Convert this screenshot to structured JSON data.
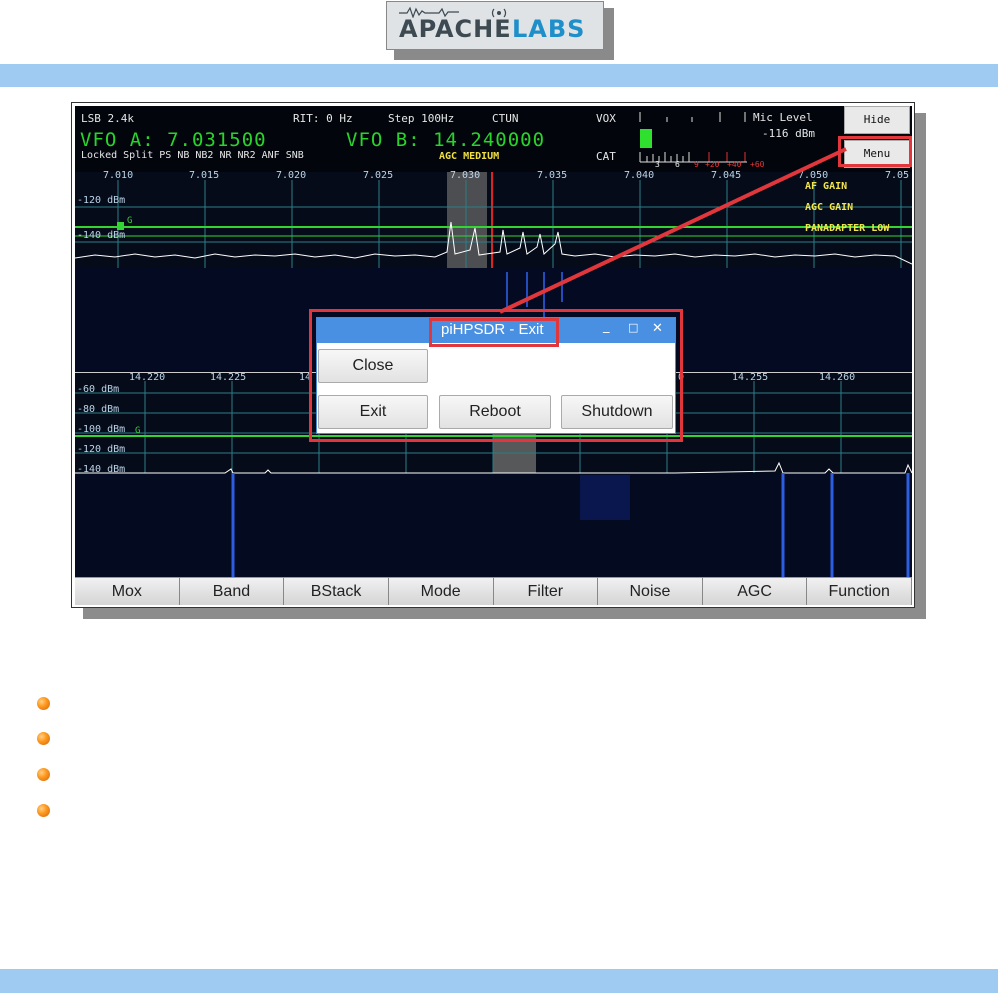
{
  "logo": {
    "word1": "APACHE",
    "word2": "LABS"
  },
  "radio": {
    "header": {
      "mode": "LSB 2.4k",
      "rit": "RIT: 0 Hz",
      "step": "Step 100Hz",
      "ctun": "CTUN",
      "vox": "VOX",
      "mic_level": "Mic Level",
      "mic_dbm": "-116 dBm",
      "cat": "CAT",
      "meter_ticks": [
        "3",
        "6",
        "9",
        "+20",
        "+40",
        "+60"
      ]
    },
    "vfo_a": "VFO A: 7.031500",
    "vfo_b": "VFO B: 14.240000",
    "status_line": "Locked Split  PS    NB  NB2 NR  NR2 ANF SNB",
    "agc_label": "AGC MEDIUM",
    "hide_label": "Hide",
    "menu_label": "Menu",
    "panadapter_a": {
      "freq_ticks": [
        "7.010",
        "7.015",
        "7.020",
        "7.025",
        "7.030",
        "7.035",
        "7.040",
        "7.045",
        "7.050",
        "7.05"
      ],
      "dbm_ticks": [
        "-120 dBm",
        "-140 dBm"
      ],
      "g_marker": "G",
      "slider_labels": [
        "AF GAIN",
        "AGC GAIN",
        "PANADAPTER LOW"
      ]
    },
    "panadapter_b": {
      "freq_ticks": [
        "14.220",
        "14.225",
        "14",
        "0",
        "14.255",
        "14.260"
      ],
      "dbm_ticks": [
        "-60 dBm",
        "-80 dBm",
        "-100 dBm",
        "-120 dBm",
        "-140 dBm"
      ],
      "g_marker": "G"
    },
    "toolbar": [
      "Mox",
      "Band",
      "BStack",
      "Mode",
      "Filter",
      "Noise",
      "AGC",
      "Function"
    ],
    "dialog": {
      "title": "piHPSDR - Exit",
      "minimize": "_",
      "maximize": "□",
      "close_icon": "✕",
      "close_btn": "Close",
      "exit_btn": "Exit",
      "reboot_btn": "Reboot",
      "shutdown_btn": "Shutdown"
    }
  },
  "colors": {
    "bluebar": "#9fcbf3",
    "vfo_green": "#29d42a",
    "annotation_red": "#e0363c",
    "dialog_title": "#4a90e2"
  }
}
